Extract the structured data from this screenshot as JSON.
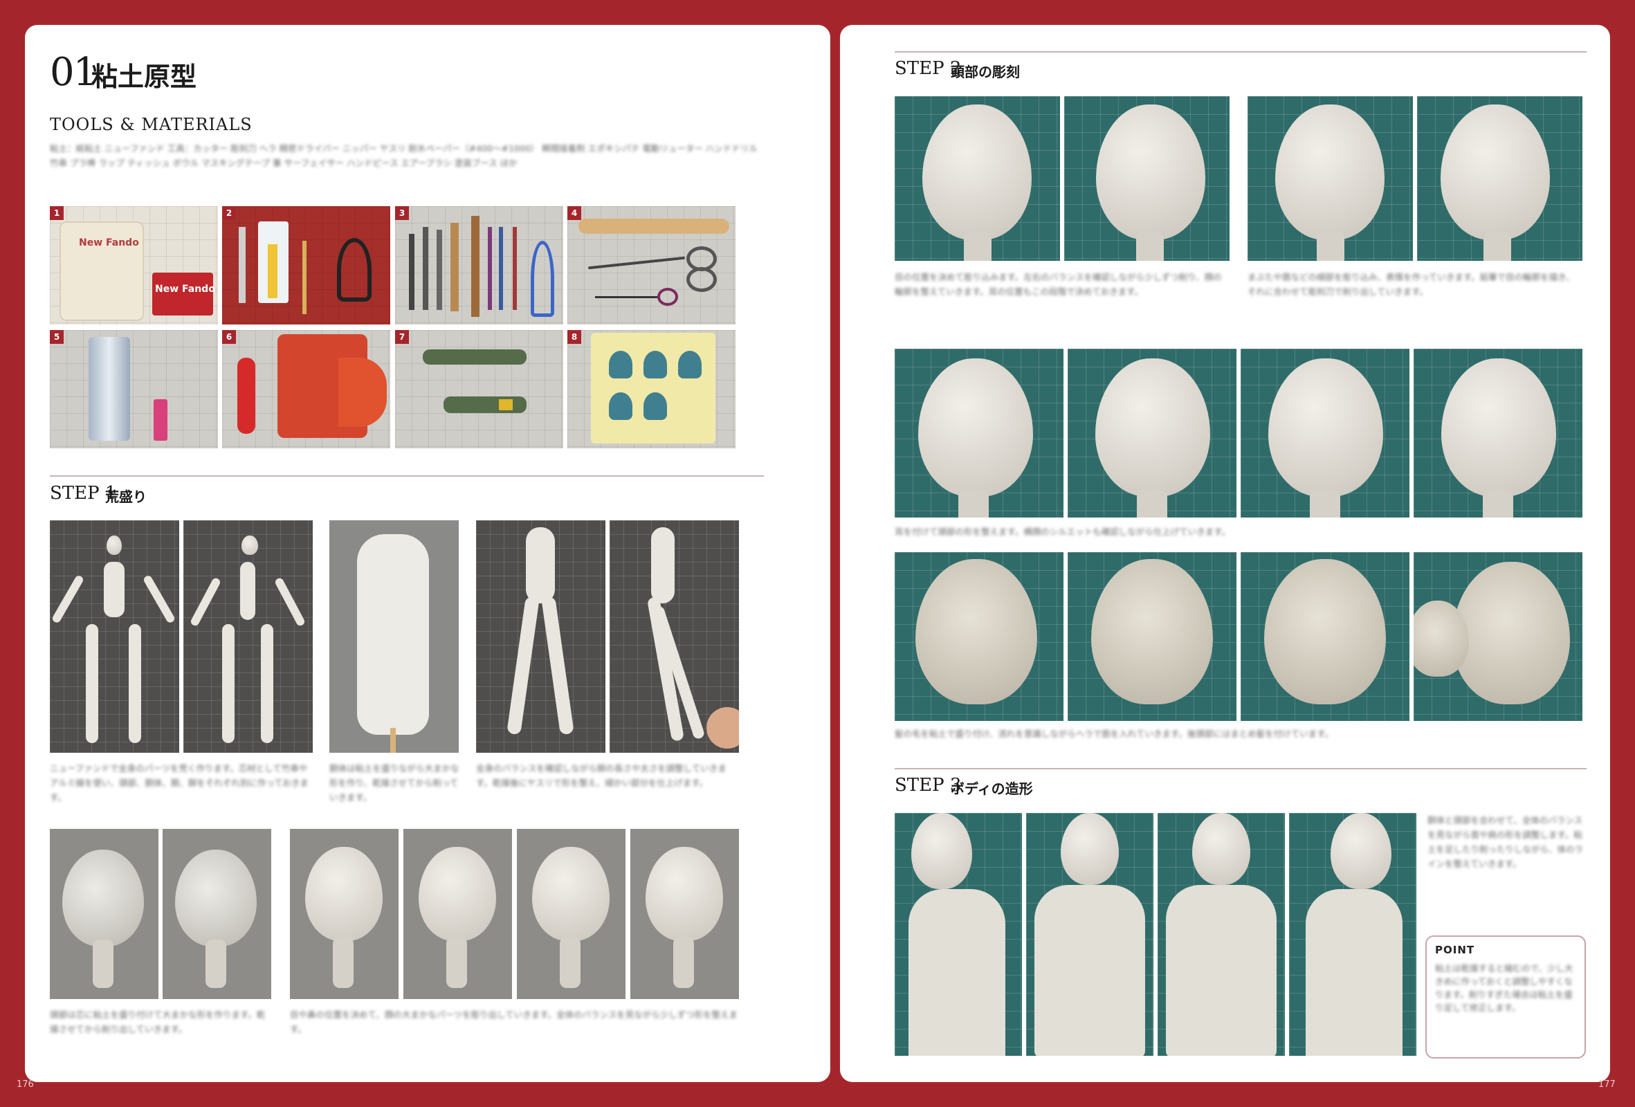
{
  "left_page": {
    "chapter_number": "01",
    "chapter_title": "粘土原型",
    "tools_heading": "TOOLS & MATERIALS",
    "tools_text": "粘土：紙粘土 ニューファンド 工具：カッター 彫刻刀 ヘラ 精密ドライバー ニッパー ヤスリ 耐水ペーパー（#400〜#1000） 瞬間接着剤 エポキシパテ 電動リューター ハンドドリル 竹串 プラ棒 ラップ ティッシュ ボウル マスキングテープ 筆 サーフェイサー ハンドピース エアーブラシ 塗装ブース ほか",
    "tool_photos": [
      {
        "num": "1",
        "label": "New Fando",
        "label2": "New Fando"
      },
      {
        "num": "2"
      },
      {
        "num": "3"
      },
      {
        "num": "4"
      },
      {
        "num": "5"
      },
      {
        "num": "6"
      },
      {
        "num": "7"
      },
      {
        "num": "8"
      }
    ],
    "step1_label": "STEP 1",
    "step1_title": "荒盛り",
    "step1_text_a": "ニューファンドで全身のパーツを荒く作ります。芯材として竹串やアルミ線を使い、頭部、胴体、腕、脚をそれぞれ別に作っておきます。",
    "step1_text_b": "胴体は粘土を盛りながら大まかな形を作り、乾燥させてから削っていきます。",
    "step1_text_c": "全身のバランスを確認しながら脚の長さや太さを調整していきます。乾燥後にヤスリで形を整え、細かい部分を仕上げます。",
    "step1_text_d": "頭部は芯に粘土を盛り付けて大まかな形を作ります。乾燥させてから削り出していきます。",
    "step1_text_e": "目や鼻の位置を決めて、顔の大まかなパーツを彫り出していきます。全体のバランスを見ながら少しずつ形を整えます。",
    "page_number": "176"
  },
  "right_page": {
    "step2_label": "STEP 2",
    "step2_title": "頭部の彫刻",
    "step2_text_a": "目の位置を決めて彫り込みます。左右のバランスを確認しながら少しずつ削り、顔の輪郭を整えていきます。耳の位置もこの段階で決めておきます。",
    "step2_text_b": "まぶたや唇などの細部を彫り込み、表情を作っていきます。鉛筆で目の輪郭を描き、それに合わせて彫刻刀で削り出していきます。",
    "step2_text_c": "耳を付けて頭部の形を整えます。横顔のシルエットも確認しながら仕上げていきます。",
    "step2_text_d": "髪の毛を粘土で盛り付け、流れを意識しながらヘラで筋を入れていきます。後頭部にはまとめ髪を付けています。",
    "step3_label": "STEP 3",
    "step3_title": "ボディの造形",
    "step3_text": "胴体と頭部を合わせて、全体のバランスを見ながら首や肩の形を調整します。粘土を足したり削ったりしながら、体のラインを整えていきます。",
    "point_label": "POINT",
    "point_text": "粘土は乾燥すると縮むので、少し大きめに作っておくと調整しやすくなります。削りすぎた場合は粘土を盛り足して修正します。",
    "page_number": "177"
  },
  "colors": {
    "border": "#a4262c",
    "page": "#ffffff",
    "rule": "#c9b3b5",
    "teal_mat": "#2f6b69"
  }
}
